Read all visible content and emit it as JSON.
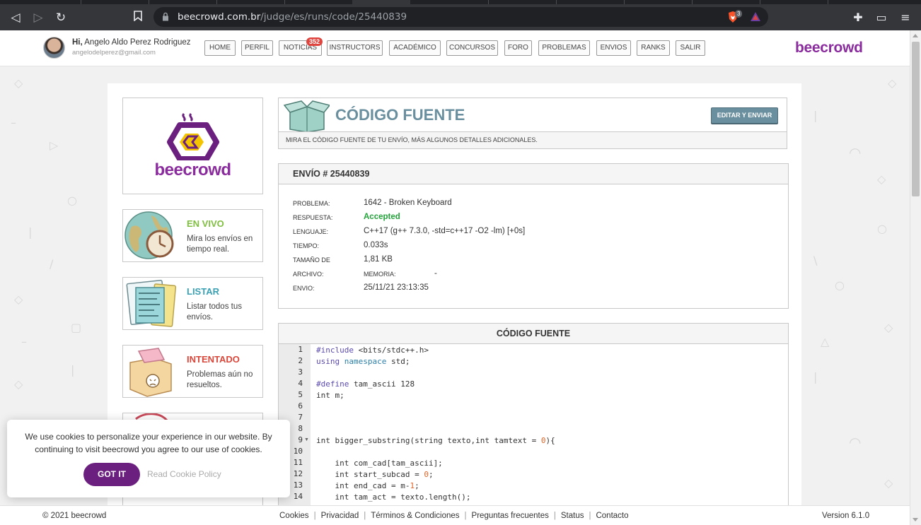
{
  "browser": {
    "url_host": "beecrowd.com.br",
    "url_path": "/judge/es/runs/code/25440839",
    "ext_badge": "3"
  },
  "header": {
    "greeting": "Hi,",
    "user_name": "Angelo Aldo Perez Rodriguez",
    "email": "angelodelperez@gmail.com",
    "brand": "beecrowd",
    "nav": [
      "HOME",
      "PERFIL",
      "NOTICIAS",
      "INSTRUCTORS",
      "ACADÉMICO",
      "CONCURSOS",
      "FORO",
      "PROBLEMAS",
      "ENVIOS",
      "RANKS",
      "SALIR"
    ],
    "notif_count": "352"
  },
  "sidebar": {
    "logo_text": "beecrowd",
    "items": [
      {
        "title": "EN VIVO",
        "desc": "Mira los envíos en tiempo real.",
        "color": "#7fbf3f"
      },
      {
        "title": "LISTAR",
        "desc": "Listar todos tus envíos.",
        "color": "#3aa0b3"
      },
      {
        "title": "INTENTADO",
        "desc": "Problemas aún no resueltos.",
        "color": "#d9473b"
      }
    ]
  },
  "source_header": {
    "title": "CÓDIGO FUENTE",
    "button": "EDITAR Y ENVIAR",
    "subtitle": "MIRA EL CÓDIGO FUENTE DE TU ENVÍO, MÁS ALGUNOS DETALLES ADICIONALES."
  },
  "envio": {
    "title": "ENVÍO # 25440839",
    "labels": {
      "problema": "PROBLEMA:",
      "respuesta": "RESPUESTA:",
      "lenguaje": "LENGUAJE:",
      "tiempo": "TIEMPO:",
      "tamano": "TAMAÑO DE",
      "archivo": "ARCHIVO:",
      "memoria": "MEMORIA:",
      "envio": "ENVIO:"
    },
    "values": {
      "problema": "1642 - Broken Keyboard",
      "respuesta": "Accepted",
      "lenguaje": "C++17 (g++ 7.3.0, -std=c++17 -O2 -lm) [+0s]",
      "tiempo": "0.033s",
      "tamano": "1,81 KB",
      "memoria": "-",
      "envio": "25/11/21 23:13:35"
    }
  },
  "code": {
    "title": "CÓDIGO FUENTE",
    "line_numbers": [
      "1",
      "2",
      "3",
      "4",
      "5",
      "6",
      "7",
      "8",
      "9",
      "10",
      "11",
      "12",
      "13",
      "14"
    ]
  },
  "cookie": {
    "message": "We use cookies to personalize your experience in our website. By continuing to visit beecrowd you agree to our use of cookies.",
    "accept": "GOT IT",
    "policy": "Read Cookie Policy"
  },
  "footer": {
    "copyright": "© 2021 beecrowd",
    "links": [
      "Cookies",
      "Privacidad",
      "Términos & Condiciones",
      "Preguntas frecuentes",
      "Status",
      "Contacto"
    ],
    "version": "Version 6.1.0"
  }
}
